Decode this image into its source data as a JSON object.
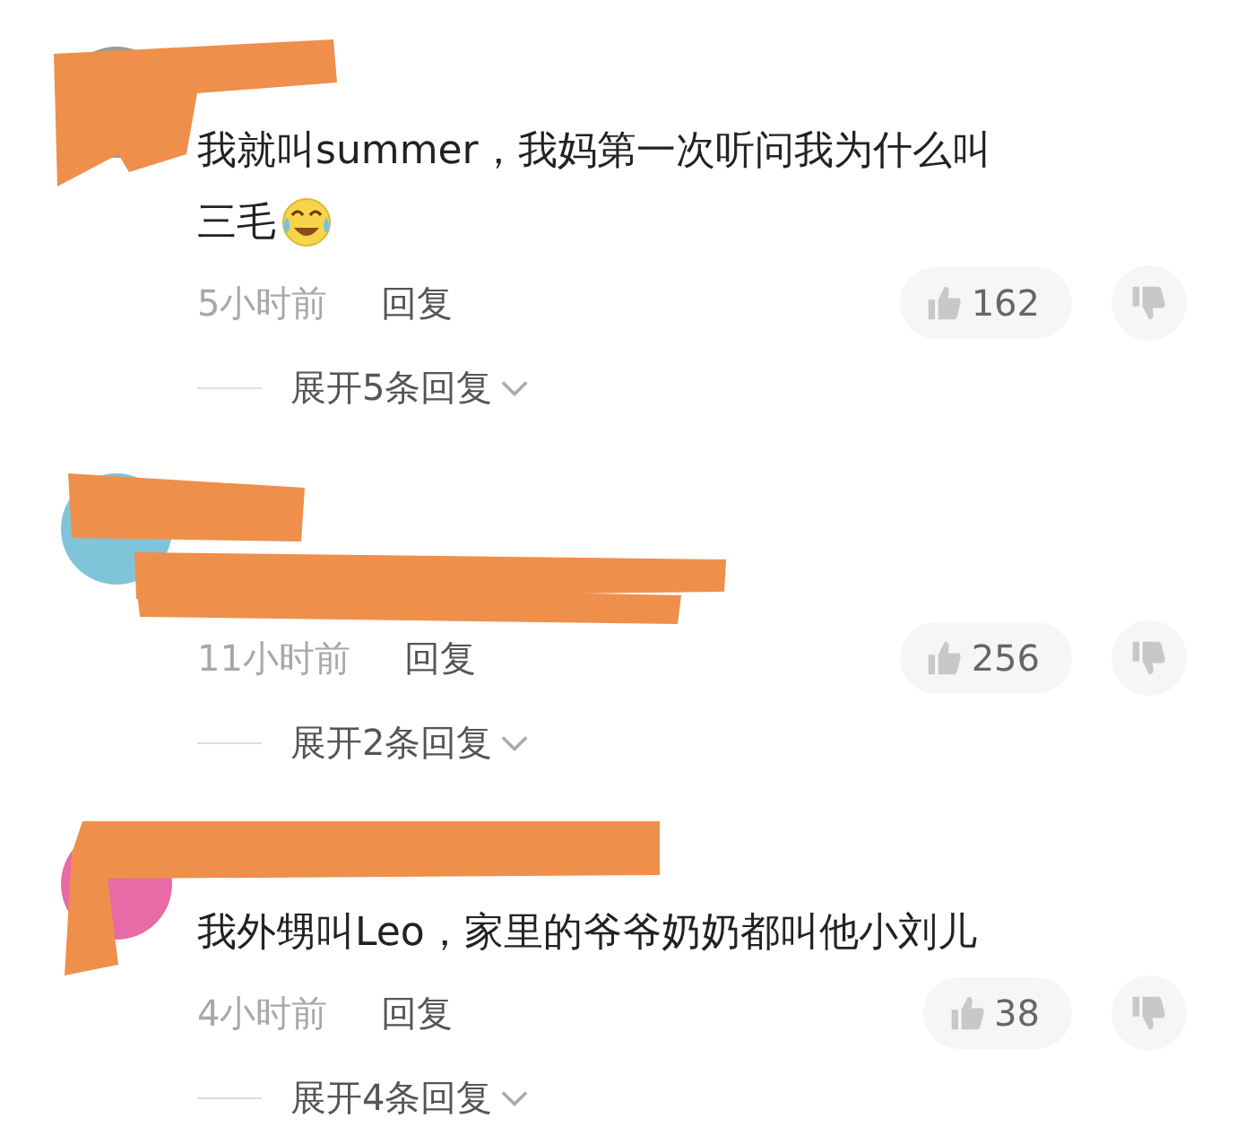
{
  "comments": [
    {
      "text_lines": [
        "我就叫summer，我妈第一次听问我为什么叫",
        "三毛"
      ],
      "trailing_emoji": true,
      "time": "5小时前",
      "reply": "回复",
      "likes": "162",
      "expand": "展开5条回复"
    },
    {
      "time": "11小时前",
      "reply": "回复",
      "likes": "256",
      "expand": "展开2条回复"
    },
    {
      "text_lines": [
        "我外甥叫Leo，家里的爷爷奶奶都叫他小刘儿"
      ],
      "time": "4小时前",
      "reply": "回复",
      "likes": "38",
      "expand": "展开4条回复"
    }
  ]
}
